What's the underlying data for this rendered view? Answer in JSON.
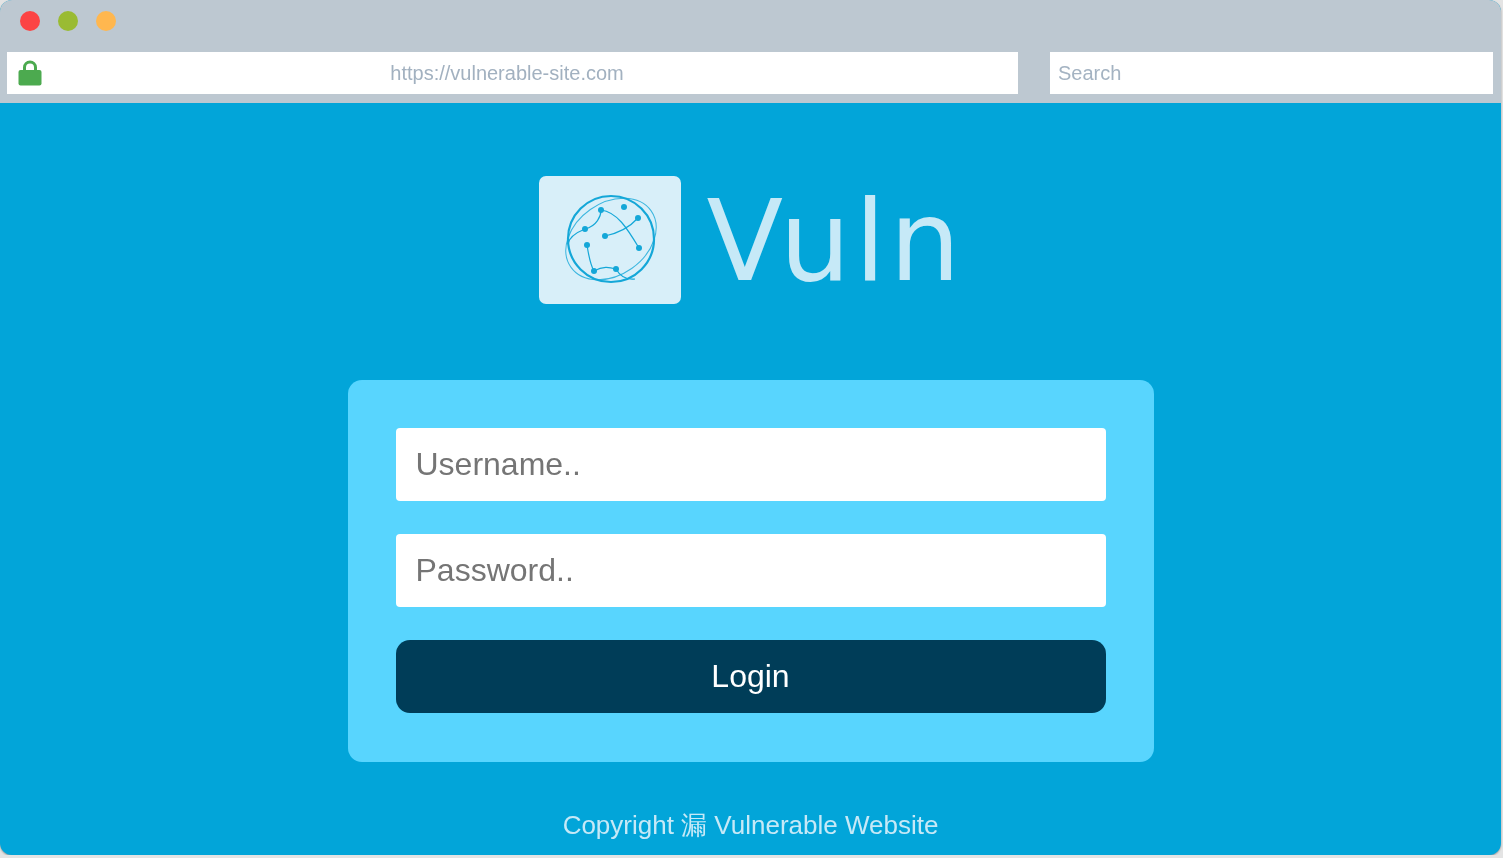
{
  "window": {
    "controls": [
      {
        "color": "#fc4444"
      },
      {
        "color": "#9abb33"
      },
      {
        "color": "#ffb74f"
      }
    ]
  },
  "address_bar": {
    "secure": true,
    "url": "https://vulnerable-site.com"
  },
  "search": {
    "placeholder": "Search"
  },
  "logo": {
    "name": "Vuln"
  },
  "login_form": {
    "username": {
      "placeholder": "Username.."
    },
    "password": {
      "placeholder": "Password.."
    },
    "button": "Login"
  },
  "footer": "Copyright 漏 Vulnerable Website"
}
